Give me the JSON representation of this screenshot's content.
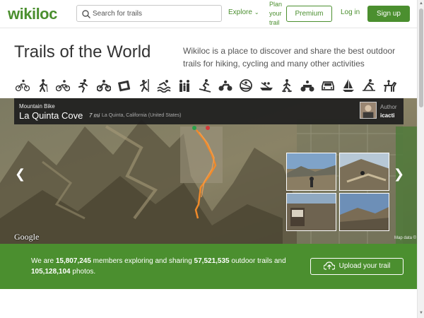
{
  "header": {
    "logo": "wikiloc",
    "search_placeholder": "Search for trails",
    "explore_label": "Explore",
    "plan_label": "Plan your trail",
    "premium_label": "Premium",
    "login_label": "Log in",
    "signup_label": "Sign up"
  },
  "hero": {
    "title": "Trails of the World",
    "description": "Wikiloc is a place to discover and share the best outdoor trails for hiking, cycling and many other activities"
  },
  "activities": [
    "mountain-bike-icon",
    "hiking-icon",
    "cycling-icon",
    "running-icon",
    "motorcycle-icon",
    "photo-album-icon",
    "climbing-icon",
    "swimming-icon",
    "family-icon",
    "skiing-icon",
    "motorbike-icon",
    "kayak-icon",
    "rafting-icon",
    "snowshoe-icon",
    "atv-icon",
    "car-icon",
    "sailing-icon",
    "cross-country-ski-icon",
    "horse-riding-icon"
  ],
  "featured": {
    "category": "Mountain Bike",
    "name": "La Quinta Cove",
    "distance": "7 mi",
    "location": "La Quinta, California (United States)",
    "author_label": "Author",
    "author_name": "icacti"
  },
  "map": {
    "provider": "Google",
    "attribution": "Map data ©"
  },
  "banner": {
    "prefix": "We are ",
    "members": "15,807,245",
    "mid1": " members exploring and sharing ",
    "trails": "57,521,535",
    "mid2": " outdoor trails and ",
    "photos": "105,128,104",
    "suffix": " photos.",
    "upload_label": "Upload your trail"
  },
  "colors": {
    "brand_green": "#4b8f2f",
    "infobar_bg": "#1e1e1e",
    "route": "#e8882c"
  }
}
